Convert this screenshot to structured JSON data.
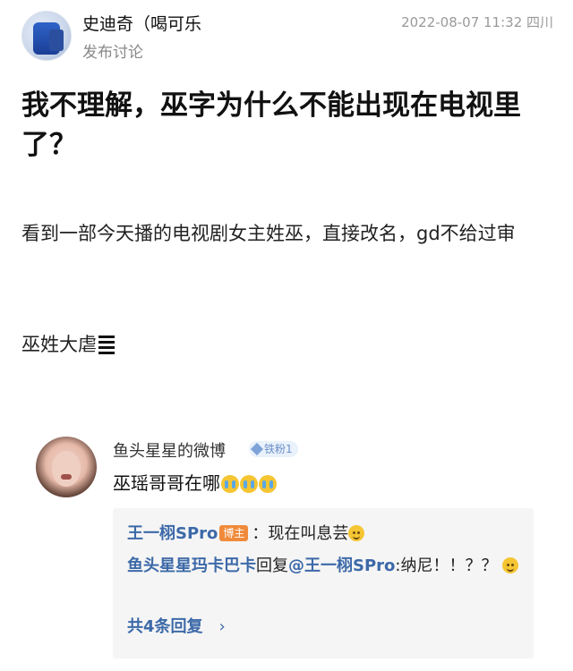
{
  "post": {
    "username": "史迪奇（喝可乐",
    "action": "发布讨论",
    "datetime": "2022-08-07 11:32 四川",
    "title": "我不理解，巫字为什么不能出现在电视里了？",
    "body_line1": "看到一部今天播的电视剧女主姓巫，直接改名，gd不给过审",
    "body_line2": "巫姓大虐"
  },
  "comment": {
    "author": "鱼头星星的微博",
    "fan_badge": "铁粉1",
    "text": "巫瑶哥哥在哪",
    "replies": [
      {
        "author": "王一栩SPro",
        "badge": "博主",
        "separator": "：",
        "text": "现在叫息芸"
      },
      {
        "author": "鱼头星星玛卡巴卡",
        "reply_word": "回复",
        "target": "@王一栩SPro",
        "text": ":纳尼！！？？"
      }
    ],
    "more_replies": "共4条回复"
  }
}
